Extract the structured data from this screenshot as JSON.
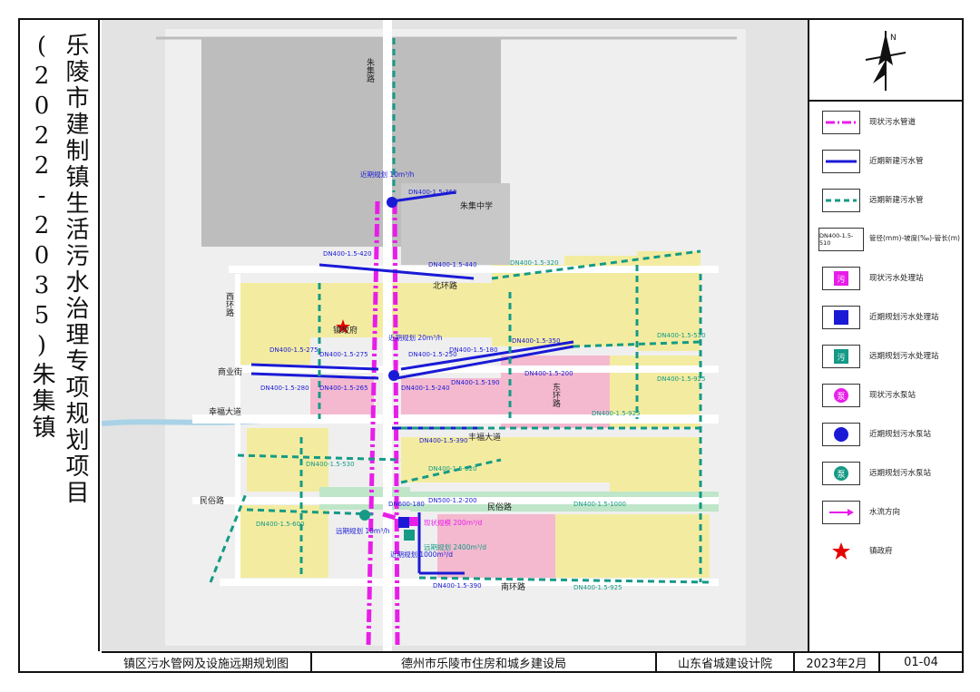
{
  "side_title": "乐陵市建制镇生活污水治理专项规划项目(2022-2035)朱集镇",
  "north_label": "N",
  "legend": [
    {
      "icon": "existing-sewer-line-icon",
      "label": "现状污水管道"
    },
    {
      "icon": "near-term-sewer-line-icon",
      "label": "近期新建污水管"
    },
    {
      "icon": "long-term-sewer-line-icon",
      "label": "远期新建污水管"
    },
    {
      "icon": "pipe-spec-box-icon",
      "box_text": "DN400-1.5-510",
      "label": "管径(mm)-坡度(‰)-管长(m)"
    },
    {
      "icon": "existing-treatment-plant-icon",
      "box_text": "污",
      "label": "现状污水处理站"
    },
    {
      "icon": "near-term-treatment-plant-icon",
      "label": "近期规划污水处理站"
    },
    {
      "icon": "long-term-treatment-plant-icon",
      "box_text": "污",
      "label": "远期规划污水处理站"
    },
    {
      "icon": "existing-pump-station-icon",
      "box_text": "泵",
      "label": "现状污水泵站"
    },
    {
      "icon": "near-term-pump-station-icon",
      "label": "近期规划污水泵站"
    },
    {
      "icon": "long-term-pump-station-icon",
      "box_text": "泵",
      "label": "远期规划污水泵站"
    },
    {
      "icon": "flow-direction-arrow-icon",
      "label": "水流方向"
    },
    {
      "icon": "town-government-star-icon",
      "label": "镇政府"
    }
  ],
  "colors": {
    "existing_sewer": "#e81ee8",
    "near_term_sewer": "#1a1ad6",
    "long_term_sewer": "#159a86",
    "town_gov": "#e60000"
  },
  "map": {
    "roads": {
      "zhuji_road": "朱集路",
      "beihuan_road": "北环路",
      "xihuan_road": "西环路",
      "shangye_street": "商业街",
      "xingfu_avenue": "幸福大道",
      "fengfu_avenue": "丰福大道",
      "minyu_road": "民俗路",
      "minyu_road_east": "民俗路",
      "nanhuan_road": "南环路",
      "donghuan_road": "东环路"
    },
    "places": {
      "town_gov": "镇政府",
      "school": "朱集中学"
    },
    "facility_notes": [
      {
        "text": "近期规划 10m³/h"
      },
      {
        "text": "近期规划 20m³/h"
      },
      {
        "text": "远期规划 10m³/h"
      },
      {
        "text": "现状规模 200m³/d"
      },
      {
        "text": "近期规划 1000m³/d"
      },
      {
        "text": "远期规划 2400m³/d"
      }
    ],
    "pipe_labels": [
      {
        "text": "DN400-1.5-360"
      },
      {
        "text": "DN400-1.5-420"
      },
      {
        "text": "DN400-1.5-440"
      },
      {
        "text": "DN400-1.5-275"
      },
      {
        "text": "DN400-1.5-275"
      },
      {
        "text": "DN400-1.5-180"
      },
      {
        "text": "DN400-1.5-350"
      },
      {
        "text": "DN400-1.5-250"
      },
      {
        "text": "DN400-1.5-280"
      },
      {
        "text": "DN400-1.5-265"
      },
      {
        "text": "DN400-1.5-240"
      },
      {
        "text": "DN400-1.5-190"
      },
      {
        "text": "DN400-1.5-390"
      },
      {
        "text": "DN400-1.5-920"
      },
      {
        "text": "DN400-1.5-530"
      },
      {
        "text": "DN400-1.5-530"
      },
      {
        "text": "DN400-1.5-320"
      },
      {
        "text": "DN400-1.5-925"
      },
      {
        "text": "DN600-180"
      },
      {
        "text": "DN500-1.2-200"
      },
      {
        "text": "DN400-1.5-600"
      },
      {
        "text": "DN400-1.5-1000"
      },
      {
        "text": "DN400-1.5-390"
      },
      {
        "text": "DN400-1.5-925"
      },
      {
        "text": "DN400-1.5-200"
      },
      {
        "text": "DN400-1.5-925"
      }
    ]
  },
  "footer": {
    "drawing_name": "镇区污水管网及设施远期规划图",
    "client": "德州市乐陵市住房和城乡建设局",
    "designer": "山东省城建设计院",
    "date": "2023年2月",
    "sheet": "01-04"
  }
}
